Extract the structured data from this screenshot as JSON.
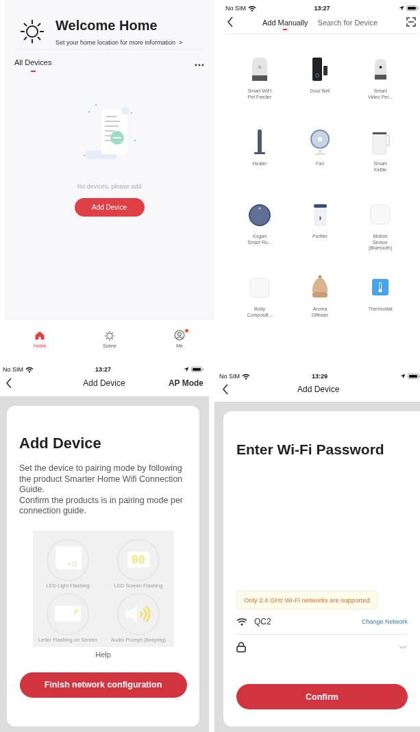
{
  "home": {
    "title": "Welcome Home",
    "subtitle": "Set your home location for more information",
    "subtitle_chevron": ">",
    "section": "All Devices",
    "empty_text": "No devices, please add",
    "add_button": "Add Device",
    "nav": [
      {
        "label": "Home",
        "kind": "home",
        "selected": true,
        "badge": false
      },
      {
        "label": "Scene",
        "kind": "scene",
        "selected": false,
        "badge": false
      },
      {
        "label": "Me",
        "kind": "me",
        "selected": false,
        "badge": true
      }
    ]
  },
  "add_manually": {
    "status": {
      "carrier": "No SIM",
      "time": "13:27"
    },
    "tabs": [
      {
        "label": "Add Manually",
        "selected": true
      },
      {
        "label": "Search for Device",
        "selected": false
      }
    ],
    "devices": [
      {
        "kind": "feeder",
        "name": "Smart WiFi\nPet Feeder"
      },
      {
        "kind": "doorbell",
        "name": "Door Bell"
      },
      {
        "kind": "camera-feeder",
        "name": "Smart\nVideo Pet..."
      },
      {
        "kind": "heater",
        "name": "Heater"
      },
      {
        "kind": "fan",
        "name": "Fan"
      },
      {
        "kind": "kettle",
        "name": "Smart\nKettle"
      },
      {
        "kind": "robot",
        "name": "Kogan\nSmart Ro..."
      },
      {
        "kind": "purifier",
        "name": "Purifier"
      },
      {
        "kind": "sensor",
        "name": "Motion\nSensor",
        "note": "(Bluetooth)"
      },
      {
        "kind": "scale",
        "name": "Body\nCompositi..."
      },
      {
        "kind": "diffuser",
        "name": "Aroma\nDiffuser"
      },
      {
        "kind": "thermostat",
        "name": "Thermostat"
      }
    ]
  },
  "ap_mode": {
    "status": {
      "carrier": "No SIM",
      "time": "13:27"
    },
    "nav_title": "Add Device",
    "nav_action": "AP Mode",
    "heading": "Add Device",
    "instructions": [
      "Set the device to pairing mode by following the product Smarter Home Wifi Connection Guide.",
      "Confirm the products is in pairing mode per connection guide."
    ],
    "modes": [
      {
        "kind": "light",
        "label": "LED Light Flashing"
      },
      {
        "kind": "screen",
        "label": "LED Screen Flashing",
        "display": "00"
      },
      {
        "kind": "letter",
        "label": "Letter Flashing on Screen",
        "display": "P"
      },
      {
        "kind": "audio",
        "label": "Audio Prompt (Beeping)"
      }
    ],
    "help": "Help",
    "button": "Finish network configuration"
  },
  "wifi_password": {
    "status": {
      "carrier": "No SIM",
      "time": "13:29"
    },
    "nav_title": "Add Device",
    "heading": "Enter Wi-Fi Password",
    "warning": "Only 2.4 GHz Wi-Fi networks are supported",
    "network": "QC2",
    "change_network": "Change Network",
    "button": "Confirm"
  }
}
